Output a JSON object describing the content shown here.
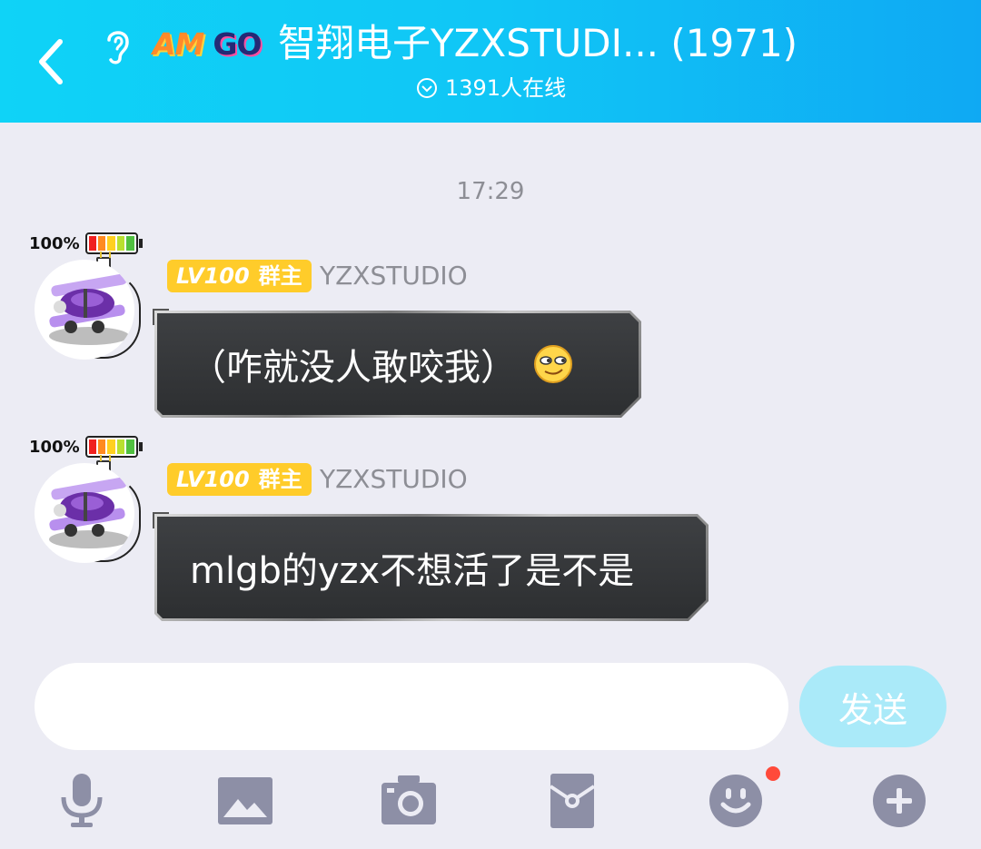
{
  "header": {
    "brand_am": "AM",
    "brand_go": "GO",
    "title": "智翔电子YZXSTUDI... (1971)",
    "online": "1391人在线"
  },
  "chat": {
    "timestamp": "17:29",
    "messages": [
      {
        "battery": "100%",
        "level": "LV100",
        "role": "群主",
        "sender": "YZXSTUDIO",
        "text": "（咋就没人敢咬我）",
        "emoji": "smirk-emoji-icon"
      },
      {
        "battery": "100%",
        "level": "LV100",
        "role": "群主",
        "sender": "YZXSTUDIO",
        "text": "mlgb的yzx不想活了是不是"
      }
    ]
  },
  "composer": {
    "input_value": "",
    "send_label": "发送"
  },
  "toolbar": [
    "microphone-icon",
    "image-icon",
    "camera-icon",
    "red-packet-icon",
    "emoji-icon",
    "plus-icon"
  ],
  "colors": {
    "header_start": "#0fd3f7",
    "header_end": "#0fa9f3",
    "badge": "#ffcc2a",
    "send_button": "#aaeaf9",
    "toolbar_icon": "#8d8fa6",
    "notify_dot": "#ff4a3a"
  }
}
